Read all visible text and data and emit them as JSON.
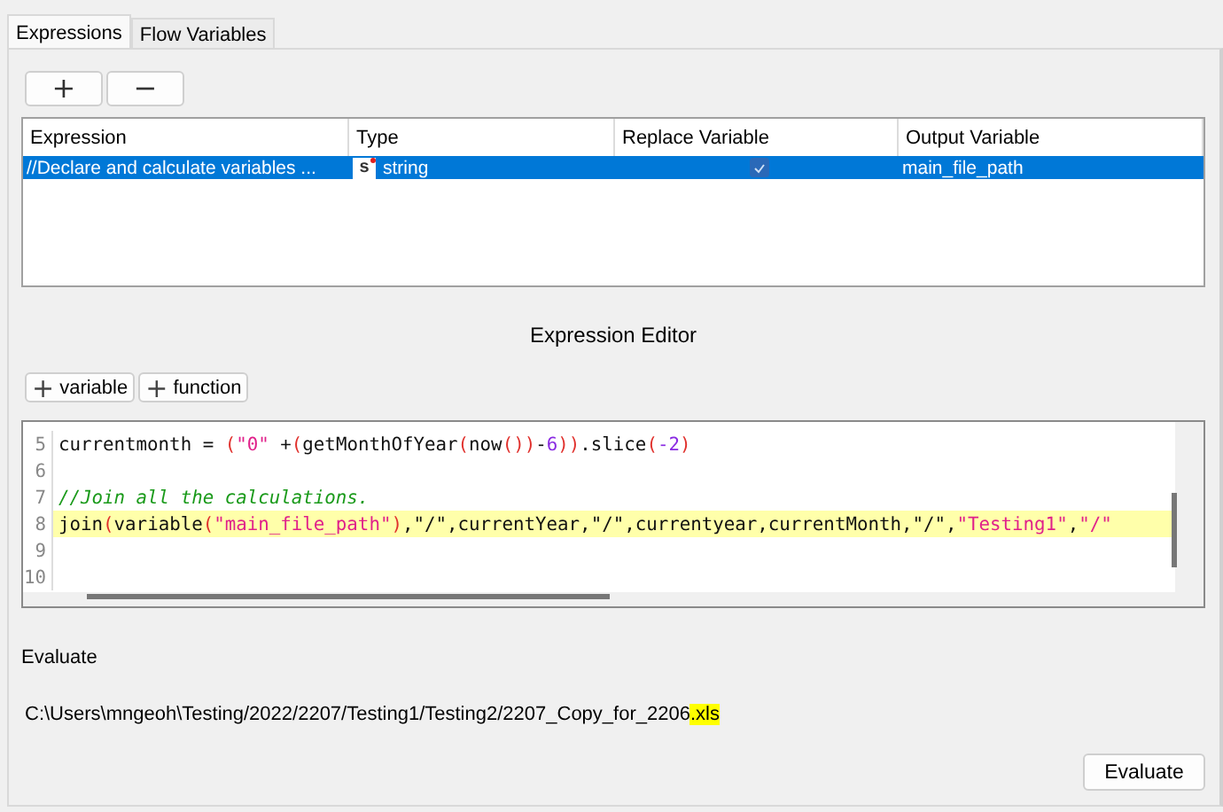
{
  "tabs": [
    {
      "label": "Expressions",
      "selected": true
    },
    {
      "label": "Flow Variables",
      "selected": false
    }
  ],
  "toolbar": {
    "buttons": [
      "+",
      "−"
    ]
  },
  "table": {
    "columns": [
      "Expression",
      "Type",
      "Replace Variable",
      "Output Variable"
    ],
    "rows": [
      {
        "expression": "//Declare and calculate variables ...",
        "type_badge": "s",
        "type": "string",
        "replace_variable": true,
        "output_variable": "main_file_path",
        "selected": true
      }
    ]
  },
  "editor": {
    "title": "Expression Editor",
    "buttons": [
      {
        "icon": "+",
        "label": "variable"
      },
      {
        "icon": "+",
        "label": "function"
      }
    ],
    "lines": [
      {
        "number": "5",
        "highlighted": false,
        "tokens": [
          {
            "text": "currentmonth = ",
            "kind": "plain"
          },
          {
            "text": "(",
            "kind": "paren"
          },
          {
            "text": "\"0\"",
            "kind": "string"
          },
          {
            "text": " +",
            "kind": "plain"
          },
          {
            "text": "(",
            "kind": "paren"
          },
          {
            "text": "getMonthOfYear",
            "kind": "plain"
          },
          {
            "text": "(",
            "kind": "paren"
          },
          {
            "text": "now",
            "kind": "plain"
          },
          {
            "text": "())",
            "kind": "paren"
          },
          {
            "text": "-",
            "kind": "plain"
          },
          {
            "text": "6",
            "kind": "number"
          },
          {
            "text": "))",
            "kind": "paren"
          },
          {
            "text": ".slice",
            "kind": "plain"
          },
          {
            "text": "(",
            "kind": "paren"
          },
          {
            "text": "-2",
            "kind": "number"
          },
          {
            "text": ")",
            "kind": "paren"
          }
        ]
      },
      {
        "number": "6",
        "highlighted": false
      },
      {
        "number": "7",
        "highlighted": false,
        "tokens": [
          {
            "text": "//Join all the calculations.",
            "kind": "comment"
          }
        ]
      },
      {
        "number": "8",
        "highlighted": true,
        "tokens": [
          {
            "text": "join",
            "kind": "plain"
          },
          {
            "text": "(",
            "kind": "paren"
          },
          {
            "text": "variable",
            "kind": "plain"
          },
          {
            "text": "(",
            "kind": "paren"
          },
          {
            "text": "\"main_file_path\"",
            "kind": "string"
          },
          {
            "text": ")",
            "kind": "paren"
          },
          {
            "text": ",\"/\",currentYear,\"/\",currentyear,currentMonth,\"/\",",
            "kind": "plain"
          },
          {
            "text": "\"Testing1\"",
            "kind": "string"
          },
          {
            "text": ",",
            "kind": "plain"
          },
          {
            "text": "\"/\"",
            "kind": "string"
          }
        ]
      },
      {
        "number": "9",
        "highlighted": false
      },
      {
        "number": "10",
        "highlighted": false
      }
    ]
  },
  "evaluate": {
    "label": "Evaluate",
    "result": [
      {
        "text": "C:\\Users\\mngeoh\\Testing/2022/2207/Testing1/Testing2/2207_Copy_for_2206",
        "highlighted": false
      },
      {
        "text": ".xls",
        "highlighted": true
      }
    ],
    "button": "Evaluate"
  }
}
